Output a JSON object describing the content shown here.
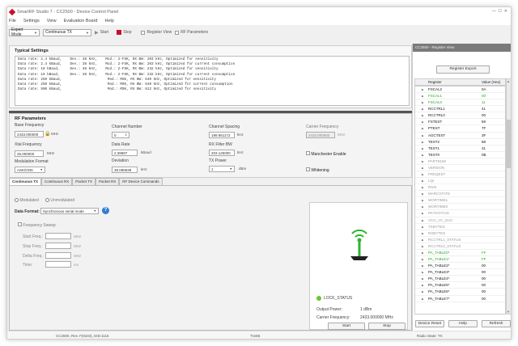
{
  "window": {
    "title": "SmartRF Studio 7 - CC2500 - Device Control Panel"
  },
  "menu": [
    "File",
    "Settings",
    "View",
    "Evaluation Board",
    "Help"
  ],
  "toolbar": {
    "mode": "Expert Mode",
    "function": "Continuous TX",
    "start": "Start",
    "stop": "Stop",
    "register_view": "Register View",
    "rf_parameters": "RF Parameters"
  },
  "typical": {
    "title": "Typical Settings",
    "rows": [
      "Data rate: 2.4 kBaud,    Dev.: 38 kHz,    Mod.: 2-FSK, RX BW: 203 kHz, Optimized for sensitivity",
      "Data rate: 2.4 kBaud,    Dev.: 38 kHz,    Mod.: 2-FSK, RX BW: 203 kHz, Optimized for current consumption",
      "Data rate: 10 kBaud,     Dev.: 38 kHz,    Mod.: 2-FSK, RX BW: 232 kHz, Optimized for sensitivity",
      "Data rate: 10 kBaud,     Dev.: 38 kHz,    Mod.: 2-FSK, RX BW: 232 kHz, Optimized for current consumption",
      "Data rate: 250 kBaud,                      Mod.: MSK, RX BW: 540 kHz, Optimized for sensitivity",
      "Data rate: 250 kBaud,                      Mod.: MSK, RX BW: 540 kHz, Optimized for current consumption",
      "Data rate: 500 kBaud,                      Mod.: MSK, RX BW: 812 kHz, Optimized for sensitivity"
    ]
  },
  "rf": {
    "title": "RF Parameters",
    "base_freq_label": "Base Frequency",
    "base_freq": "2433.000000",
    "base_freq_unit": "MHz",
    "channel_label": "Channel Number",
    "channel": "0",
    "spacing_label": "Channel Spacing",
    "spacing": "199.951172",
    "spacing_unit": "kHz",
    "carrier_label": "Carrier Frequency",
    "carrier": "2433.000000",
    "carrier_unit": "MHz",
    "xtal_label": "Xtal Frequency",
    "xtal": "26.000000",
    "xtal_unit": "MHz",
    "rate_label": "Data Rate",
    "rate": "2.39897",
    "rate_unit": "kBaud",
    "rxbw_label": "RX Filter BW",
    "rxbw": "203.125000",
    "rxbw_unit": "kHz",
    "manchester": "Manchester Enable",
    "mod_label": "Modulation Format",
    "mod": "ASK/OOK",
    "dev_label": "Deviation",
    "dev": "38.085938",
    "dev_unit": "kHz",
    "txp_label": "TX Power",
    "txp": "1",
    "txp_unit": "dBm",
    "whitening": "Whitening"
  },
  "tabs": [
    "Continuous TX",
    "Continuous RX",
    "Packet TX",
    "Packet RX",
    "RF Device Commands"
  ],
  "ctx": {
    "modulated": "Modulated",
    "unmodulated": "Unmodulated",
    "format_label": "Data Format:",
    "format": "Synchronous serial mode",
    "sweep": "Frequency Sweep",
    "start_label": "Start Freq.:",
    "stop_label": "Stop Freq.:",
    "delta_label": "Delta Freq.:",
    "time_label": "Time:",
    "mhz": "MHz",
    "ms": "ms",
    "lock": "LOCK_STATUS",
    "out_label": "Output Power:",
    "out": "1 dBm",
    "cf_label": "Carrier Frequency:",
    "cf": "2433.000000 MHz",
    "start": "Start",
    "stop": "Stop"
  },
  "reg": {
    "title": "CC2500 - Register View",
    "export": "Register Export",
    "col_reg": "Register",
    "col_val": "Value (Hex)",
    "rows": [
      {
        "n": "FSCAL2",
        "v": "0A",
        "c": "#111"
      },
      {
        "n": "FSCAL1",
        "v": "00",
        "c": "#22aa22"
      },
      {
        "n": "FSCAL0",
        "v": "11",
        "c": "#22aa22"
      },
      {
        "n": "RCCTRL1",
        "v": "41",
        "c": "#111"
      },
      {
        "n": "RCCTRL0",
        "v": "00",
        "c": "#111"
      },
      {
        "n": "FSTEST",
        "v": "59",
        "c": "#111"
      },
      {
        "n": "PTEST",
        "v": "7F",
        "c": "#111"
      },
      {
        "n": "AGCTEST",
        "v": "3F",
        "c": "#111"
      },
      {
        "n": "TEST2",
        "v": "88",
        "c": "#111"
      },
      {
        "n": "TEST1",
        "v": "31",
        "c": "#111"
      },
      {
        "n": "TEST0",
        "v": "0B",
        "c": "#111"
      },
      {
        "n": "PARTNUM",
        "v": "",
        "c": "#999"
      },
      {
        "n": "VERSION",
        "v": "",
        "c": "#999"
      },
      {
        "n": "FREQEST",
        "v": "",
        "c": "#999"
      },
      {
        "n": "LQI",
        "v": "",
        "c": "#999"
      },
      {
        "n": "RSSI",
        "v": "",
        "c": "#999"
      },
      {
        "n": "MARCSTATE",
        "v": "",
        "c": "#999"
      },
      {
        "n": "WORTIME1",
        "v": "",
        "c": "#999"
      },
      {
        "n": "WORTIME0",
        "v": "",
        "c": "#999"
      },
      {
        "n": "PKTSTATUS",
        "v": "",
        "c": "#999"
      },
      {
        "n": "VCO_VC_DAC",
        "v": "",
        "c": "#999"
      },
      {
        "n": "TXBYTES",
        "v": "",
        "c": "#999"
      },
      {
        "n": "RXBYTES",
        "v": "",
        "c": "#999"
      },
      {
        "n": "RCCTRL1_STATUS",
        "v": "",
        "c": "#999"
      },
      {
        "n": "RCCTRL0_STATUS",
        "v": "",
        "c": "#999"
      },
      {
        "n": "PA_TABLE0*",
        "v": "FF",
        "c": "#22aa22"
      },
      {
        "n": "PA_TABLE1*",
        "v": "FF",
        "c": "#22aa22"
      },
      {
        "n": "PA_TABLE2*",
        "v": "00",
        "c": "#111"
      },
      {
        "n": "PA_TABLE3*",
        "v": "00",
        "c": "#111"
      },
      {
        "n": "PA_TABLE4*",
        "v": "00",
        "c": "#111"
      },
      {
        "n": "PA_TABLE5*",
        "v": "00",
        "c": "#111"
      },
      {
        "n": "PA_TABLE6*",
        "v": "00",
        "c": "#111"
      },
      {
        "n": "PA_TABLE7*",
        "v": "00",
        "c": "#111"
      }
    ],
    "reset": "Device Reset",
    "help": "Help",
    "refresh": "Refresh"
  },
  "status": {
    "device": "CC2500, Rev. F(0x03), DID:1116",
    "chip": "TrxEB",
    "radio": "Radio State: TX"
  }
}
